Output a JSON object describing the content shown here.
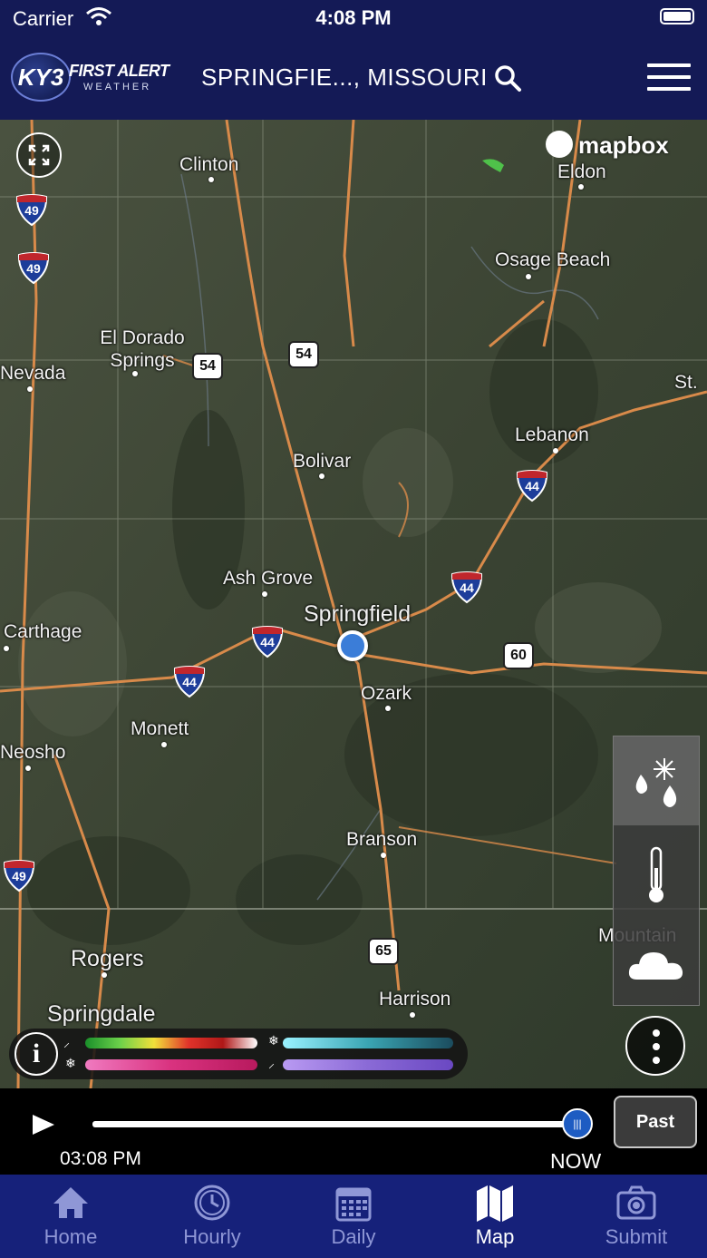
{
  "status_bar": {
    "carrier": "Carrier",
    "time": "4:08 PM"
  },
  "header": {
    "logo_badge": "KY3",
    "logo_brand": "FIRST ALERT",
    "logo_sub": "WEATHER",
    "location": "SPRINGFIE..., MISSOURI"
  },
  "map": {
    "attribution": "mapbox",
    "cities": [
      "Clinton",
      "Eldon",
      "Osage Beach",
      "El Dorado Springs",
      "Nevada",
      "St.",
      "Lebanon",
      "Bolivar",
      "Ash Grove",
      "Springfield",
      "Carthage",
      "Monett",
      "Ozark",
      "Neosho",
      "Branson",
      "Mountain",
      "Rogers",
      "Springdale",
      "Harrison"
    ],
    "interstate_shields": [
      "49",
      "49",
      "44",
      "44",
      "44",
      "44",
      "49"
    ],
    "us_shields": [
      "54",
      "54",
      "60",
      "65"
    ]
  },
  "legend": {
    "info_symbol": "i"
  },
  "layers_panel": {
    "items": [
      "precipitation-layer",
      "temperature-layer",
      "clouds-layer"
    ],
    "active": "precipitation-layer"
  },
  "timeline": {
    "past_time": "03:08 PM",
    "now_label": "NOW",
    "mode_button": "Past",
    "progress": 1.0
  },
  "tab_bar": {
    "items": [
      {
        "label": "Home",
        "icon": "home-icon"
      },
      {
        "label": "Hourly",
        "icon": "clock-icon"
      },
      {
        "label": "Daily",
        "icon": "calendar-icon"
      },
      {
        "label": "Map",
        "icon": "map-icon"
      },
      {
        "label": "Submit",
        "icon": "camera-icon"
      }
    ],
    "active": "Map"
  },
  "colors": {
    "header_bg": "#141a56",
    "tabbar_bg": "#16217a",
    "accent_blue": "#1e5cc2",
    "road": "#d88a4a"
  }
}
